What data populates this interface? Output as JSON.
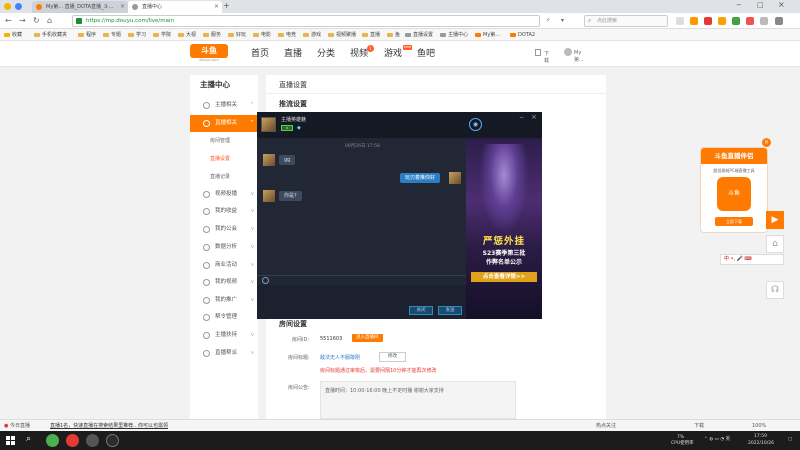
{
  "browser": {
    "tabs": [
      {
        "label": "My第... 直播_DOTA直播_斗鱼...",
        "active": false
      },
      {
        "label": "直播中心",
        "active": true
      }
    ],
    "url": "https://mp.douyu.com/live/main",
    "search_placeholder": "点此搜索",
    "bookmarks": [
      "收藏",
      "手机收藏夹",
      "程序",
      "专题",
      "学习",
      "学院",
      "大视",
      "服务",
      "好玩",
      "电影",
      "电竞",
      "游戏",
      "视频聚播",
      "直播",
      "鱼",
      "直播设置",
      "主播中心",
      "My第...",
      "DOTA2"
    ]
  },
  "site": {
    "logo": "斗鱼",
    "logo_domain": "douyu.com",
    "nav": [
      "首页",
      "直播",
      "分类",
      "视频",
      "游戏",
      "鱼吧"
    ],
    "video_badge": "1",
    "game_badge": "new",
    "header_right": {
      "download": "下载",
      "user": "My第..."
    }
  },
  "sidebar": {
    "title": "主播中心",
    "items": [
      {
        "label": "主播相关",
        "arrow": "^"
      },
      {
        "label": "直播相关",
        "arrow": "^",
        "active": true
      },
      {
        "label": "房间管理",
        "sub": true
      },
      {
        "label": "直播设置",
        "sub": true,
        "current": true
      },
      {
        "label": "直播记录",
        "sub": true
      },
      {
        "label": "视频投播",
        "arrow": "v"
      },
      {
        "label": "我的收益",
        "arrow": "v"
      },
      {
        "label": "我的公会",
        "arrow": "v"
      },
      {
        "label": "数据分析",
        "arrow": "v"
      },
      {
        "label": "商业活动",
        "arrow": "v"
      },
      {
        "label": "我的视频",
        "arrow": "v"
      },
      {
        "label": "我的推广",
        "arrow": "v"
      },
      {
        "label": "帮令管理",
        "arrow": ""
      },
      {
        "label": "主播扶持",
        "arrow": "v"
      },
      {
        "label": "直播帮派",
        "arrow": "v"
      }
    ]
  },
  "content": {
    "title": "直播设置",
    "section1": "推流设置",
    "section2": "房间设置",
    "room_id_label": "房间ID:",
    "room_id": "5511603",
    "room_id_button": "进入直播间",
    "room_title_label": "房间标题:",
    "room_title": "敌法无人不服敢刚",
    "edit_button": "修改",
    "warning": "房间标题通过审核后，需要间隔10分钟才能再次修改",
    "announcement_label": "房间公告:",
    "announcement": "直播时间：10:00-16:00 晚上不定时播 谢谢大家支持"
  },
  "chat": {
    "name": "主播英雄魅",
    "tag": "v",
    "time": "09月26日 17:58",
    "messages": [
      {
        "from": "other",
        "text": "gg"
      },
      {
        "from": "me",
        "text": "玩刃着推你好"
      },
      {
        "from": "other",
        "text": "你是?"
      }
    ],
    "close_button": "关闭",
    "send_button": "发送",
    "ad": {
      "line1": "严惩外挂",
      "line2": "S23赛季第三批",
      "line3": "作弊名单公示",
      "button": "点击查看详情>>"
    }
  },
  "promo": {
    "title": "斗鱼直播伴侣",
    "desc": "超低损耗PC端直播工具",
    "img_label": "斗鱼",
    "button": "立即下载"
  },
  "ime": "中 •, 🎤 ⌨",
  "statusbar": {
    "left1": "今日直播",
    "news": "直播1名，快速直播在搜索结果里推荐...你可以也需领",
    "right": [
      "热点关注",
      "下载",
      "100%"
    ]
  },
  "taskbar": {
    "cpu": "7%",
    "cpu_label": "CPU使用率",
    "time": "17:59",
    "date": "2022/10/26"
  },
  "colors": {
    "accent": "#ff7a00",
    "chat_bg": "#222735",
    "taskbar": "#1c1c1c"
  }
}
